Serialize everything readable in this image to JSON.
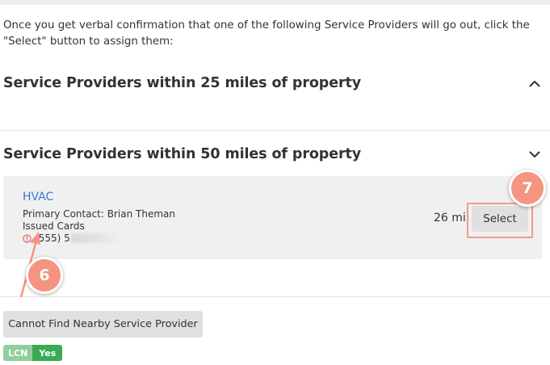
{
  "intro_text": "Once you get verbal confirmation that one of the following Service Providers will go out, click the \"Select\" button to assign them:",
  "sections": [
    {
      "title": "Service Providers within 25 miles of property",
      "expanded": false
    },
    {
      "title": "Service Providers within 50 miles of property",
      "expanded": true
    }
  ],
  "provider": {
    "name": "HVAC",
    "contact": "Primary Contact: Brian Theman",
    "cards": "Issued Cards",
    "phone_partial": "(555) 5",
    "distance": "26 mi",
    "select_label": "Select"
  },
  "annotations": {
    "marker_6": "6",
    "marker_7": "7",
    "marker_color": "#f59480"
  },
  "cannot_find_label": "Cannot Find Nearby Service Provider",
  "badge": {
    "key": "LCN",
    "value": "Yes"
  },
  "colors": {
    "link": "#3a78c9",
    "badge_green": "#3aaa54",
    "highlight_border": "#f19b8a",
    "warning_red": "#e05b5b"
  }
}
